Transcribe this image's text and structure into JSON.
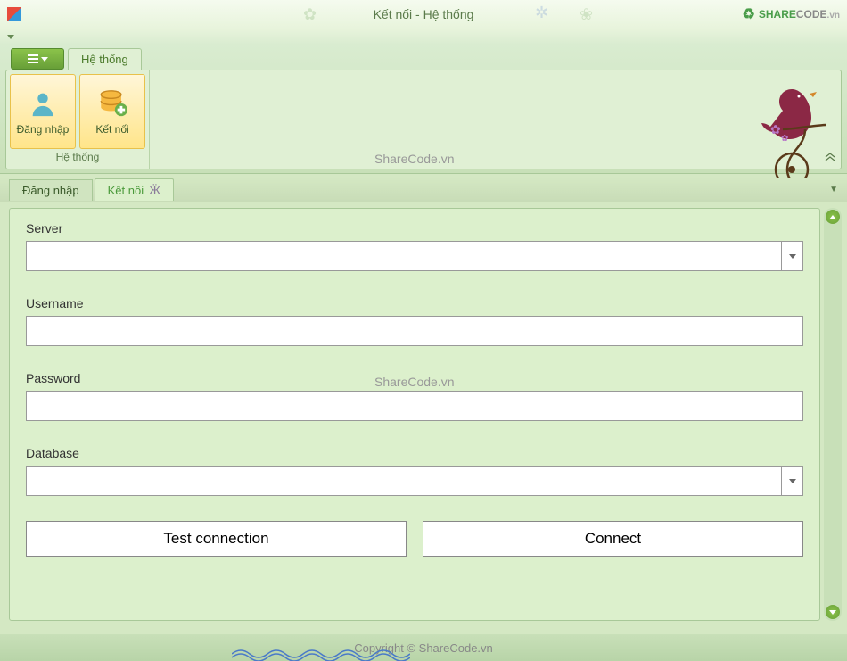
{
  "window": {
    "title": "Kết nối - Hệ thống"
  },
  "watermark_brand": {
    "share": "SHARE",
    "code": "CODE",
    "suffix": ".vn",
    "text": "ShareCode.vn"
  },
  "ribbon": {
    "tab_label": "Hệ thống",
    "group_label": "Hệ thống",
    "buttons": {
      "login": "Đăng nhập",
      "connect": "Kết nối"
    }
  },
  "content_tabs": {
    "login": "Đăng nhập",
    "connect": "Kết nối"
  },
  "form": {
    "server_label": "Server",
    "server_value": "",
    "username_label": "Username",
    "username_value": "",
    "password_label": "Password",
    "password_value": "",
    "database_label": "Database",
    "database_value": "",
    "test_button": "Test connection",
    "connect_button": "Connect"
  },
  "footer": {
    "copyright": "Copyright © ShareCode.vn"
  }
}
